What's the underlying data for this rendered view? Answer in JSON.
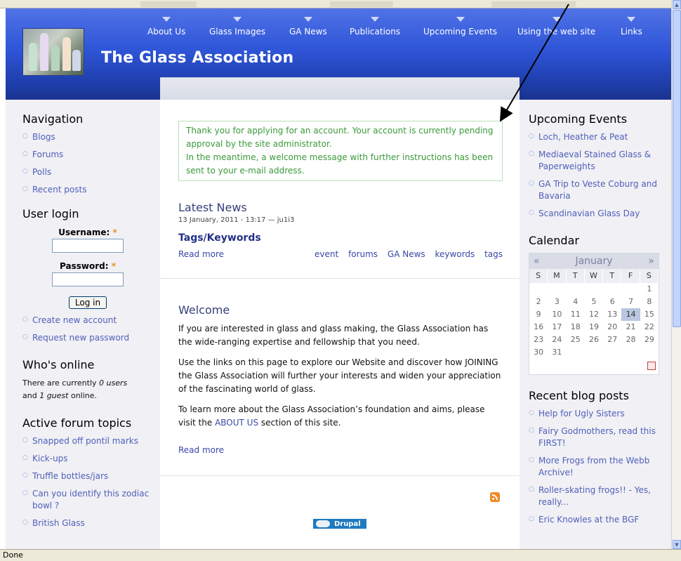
{
  "site": {
    "name": "The Glass Association"
  },
  "nav": [
    {
      "label": "About Us"
    },
    {
      "label": "Glass Images"
    },
    {
      "label": "GA News"
    },
    {
      "label": "Publications"
    },
    {
      "label": "Upcoming Events"
    },
    {
      "label": "Using the web site"
    },
    {
      "label": "Links"
    }
  ],
  "left": {
    "navigation": {
      "title": "Navigation",
      "items": [
        "Blogs",
        "Forums",
        "Polls",
        "Recent posts"
      ]
    },
    "login": {
      "title": "User login",
      "username_label": "Username:",
      "password_label": "Password:",
      "required_mark": "*",
      "button": "Log in",
      "links": [
        "Create new account",
        "Request new password"
      ]
    },
    "online": {
      "title": "Who's online",
      "line1": "There are currently ",
      "users": "0 users",
      "line2": "and ",
      "guests": "1 guest",
      "line3": " online."
    },
    "forum": {
      "title": "Active forum topics",
      "items": [
        "Snapped off pontil marks",
        "Kick-ups",
        "Truffle bottles/jars",
        "Can you identify this zodiac bowl ?",
        "British Glass"
      ]
    }
  },
  "main": {
    "message": {
      "line1": "Thank you for applying for an account. Your account is currently pending approval by the site administrator.",
      "line2": "In the meantime, a welcome message with further instructions has been sent to your e-mail address."
    },
    "news": {
      "title": "Latest News",
      "meta": "13 January, 2011 - 13:17 — ju1i3",
      "subtitle": "Tags/Keywords",
      "read_more": "Read more",
      "tags": [
        "event",
        "forums",
        "GA News",
        "keywords",
        "tags"
      ]
    },
    "welcome": {
      "title": "Welcome",
      "p1": "If you are interested in glass and glass making, the Glass Association has the wide-ranging expertise and fellowship that you need.",
      "p2": "Use the links on this page to explore our Website and discover how JOINING the Glass Association will further your interests and widen your appreciation of the fascinating world of glass.",
      "p3_before": "To learn more about the Glass Association’s foundation and aims, please visit the ",
      "p3_link": "ABOUT US",
      "p3_after": " section of this site.",
      "read_more": "Read more"
    },
    "footer": {
      "powered": "Drupal"
    }
  },
  "right": {
    "events": {
      "title": "Upcoming Events",
      "items": [
        "Loch, Heather & Peat",
        "Mediaeval Stained Glass & Paperweights",
        "GA Trip to Veste Coburg and Bavaria",
        "Scandinavian Glass Day"
      ]
    },
    "calendar": {
      "title": "Calendar",
      "month": "January",
      "prev": "«",
      "next": "»",
      "day_names": [
        "S",
        "M",
        "T",
        "W",
        "T",
        "F",
        "S"
      ],
      "days": [
        "",
        "",
        "",
        "",
        "",
        "",
        "1",
        "2",
        "3",
        "4",
        "5",
        "6",
        "7",
        "8",
        "9",
        "10",
        "11",
        "12",
        "13",
        "14",
        "15",
        "16",
        "17",
        "18",
        "19",
        "20",
        "21",
        "22",
        "23",
        "24",
        "25",
        "26",
        "27",
        "28",
        "29",
        "30",
        "31",
        "",
        "",
        "",
        "",
        ""
      ],
      "today": "14"
    },
    "blog": {
      "title": "Recent blog posts",
      "items": [
        "Help for Ugly Sisters",
        "Fairy Godmothers, read this FIRST!",
        "More Frogs from the Webb Archive!",
        "Roller-skating frogs!! - Yes, really...",
        "Eric Knowles at the BGF"
      ]
    }
  },
  "status": {
    "text": "Done"
  },
  "colors": {
    "header": "#2f55d8",
    "link": "#3a48a8",
    "message": "#3a9a3a"
  }
}
